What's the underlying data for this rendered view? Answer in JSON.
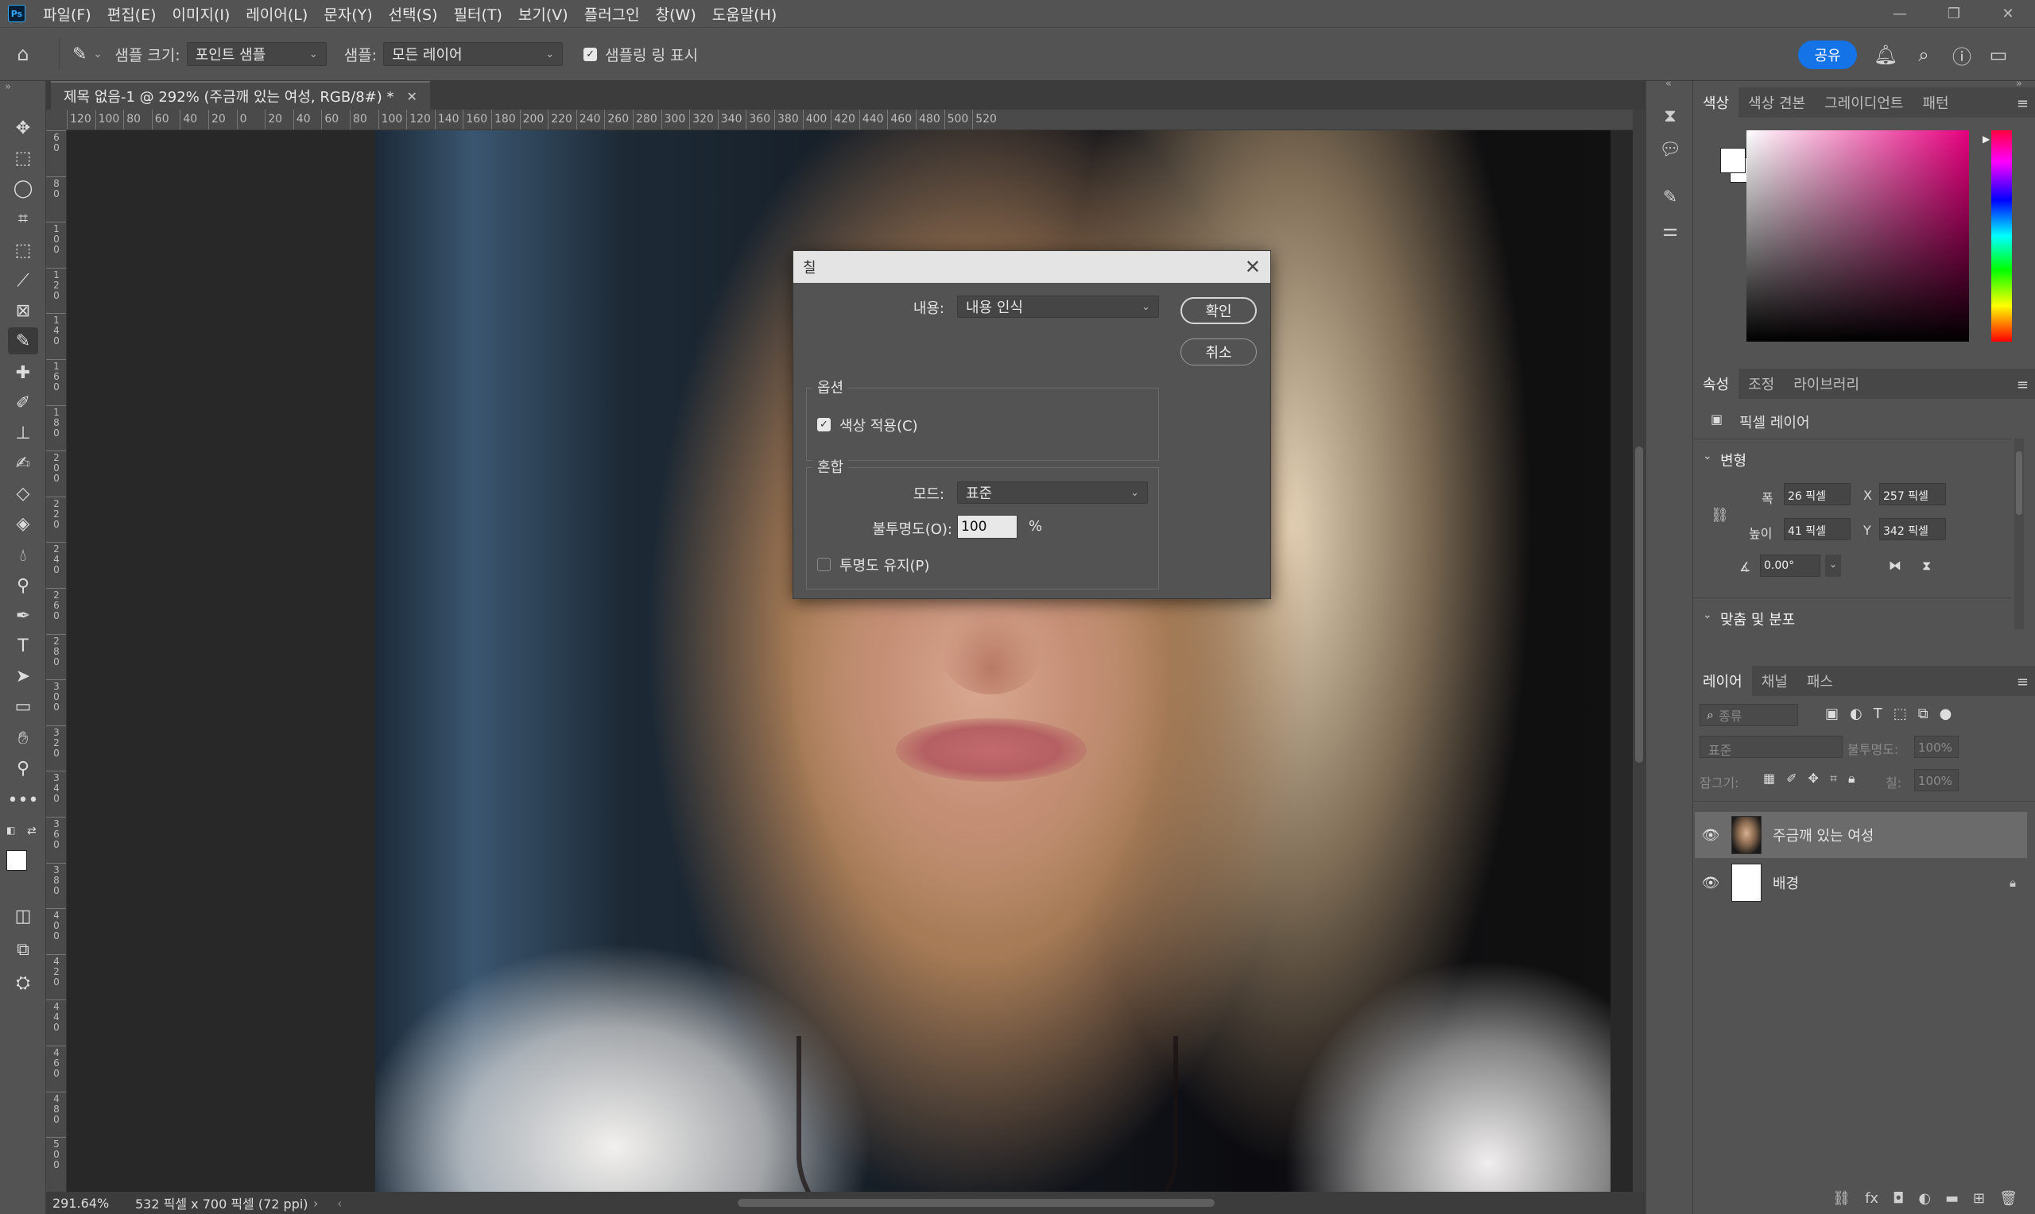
{
  "app": {
    "logo": "Ps",
    "menu": [
      "파일(F)",
      "편집(E)",
      "이미지(I)",
      "레이어(L)",
      "문자(Y)",
      "선택(S)",
      "필터(T)",
      "보기(V)",
      "플러그인",
      "창(W)",
      "도움말(H)"
    ]
  },
  "options": {
    "sample_size_label": "샘플 크기:",
    "sample_size_value": "포인트 샘플",
    "sample_label": "샘플:",
    "sample_value": "모든 레이어",
    "show_ring_label": "샘플링 링 표시",
    "share_label": "공유"
  },
  "document": {
    "tab_title": "제목 없음-1 @ 292% (주금깨 있는 여성, RGB/8#) *",
    "hruler_ticks": [
      "120",
      "100",
      "80",
      "60",
      "40",
      "20",
      "0",
      "20",
      "40",
      "60",
      "80",
      "100",
      "120",
      "140",
      "160",
      "180",
      "200",
      "220",
      "240",
      "260",
      "280",
      "300",
      "320",
      "340",
      "360",
      "380",
      "400",
      "420",
      "440",
      "460",
      "480",
      "500",
      "520"
    ],
    "vruler_ticks": [
      "6 0",
      "8 0",
      "1 0 0",
      "1 2 0",
      "1 4 0",
      "1 6 0",
      "1 8 0",
      "2 0 0",
      "2 2 0",
      "2 4 0",
      "2 6 0",
      "2 8 0",
      "3 0 0",
      "3 2 0",
      "3 4 0",
      "3 6 0",
      "3 8 0",
      "4 0 0",
      "4 2 0",
      "4 4 0",
      "4 6 0",
      "4 8 0",
      "5 0 0"
    ]
  },
  "status": {
    "zoom": "291.64%",
    "doc_info": "532 픽셀 x 700 픽셀 (72 ppi)"
  },
  "color_panel": {
    "tabs": [
      "색상",
      "색상 견본",
      "그레이디언트",
      "패턴"
    ]
  },
  "properties_panel": {
    "tabs": [
      "속성",
      "조정",
      "라이브러리"
    ],
    "kind": "픽셀 레이어",
    "transform_label": "변형",
    "width_label": "폭",
    "width_value": "26 픽셀",
    "x_label": "X",
    "x_value": "257 픽셀",
    "height_label": "높이",
    "height_value": "41 픽셀",
    "y_label": "Y",
    "y_value": "342 픽셀",
    "angle_value": "0.00°",
    "align_label": "맞춤 및 분포"
  },
  "layers_panel": {
    "tabs": [
      "레이어",
      "채널",
      "패스"
    ],
    "filter_placeholder": "종류",
    "blend_mode": "표준",
    "opacity_label": "불투명도:",
    "opacity_value": "100%",
    "lock_label": "잠그기:",
    "fill_label": "칠:",
    "fill_value": "100%",
    "layers": [
      {
        "name": "주금깨 있는 여성",
        "selected": true
      },
      {
        "name": "배경",
        "selected": false
      }
    ]
  },
  "fill_dialog": {
    "title": "칠",
    "contents_label": "내용:",
    "contents_value": "내용 인식",
    "ok_label": "확인",
    "cancel_label": "취소",
    "options_title": "옵션",
    "color_adapt_label": "색상 적용(C)",
    "blend_title": "혼합",
    "mode_label": "모드:",
    "mode_value": "표준",
    "opacity_label": "불투명도(O):",
    "opacity_value": "100",
    "percent": "%",
    "preserve_label": "투명도 유지(P)"
  },
  "colors": {
    "accent": "#1473e6",
    "bg": "#535353"
  }
}
